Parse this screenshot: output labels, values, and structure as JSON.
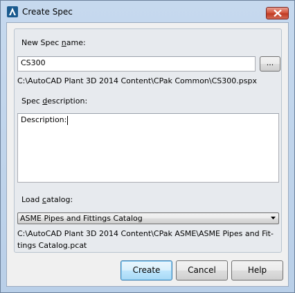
{
  "window": {
    "title": "Create Spec",
    "app_icon": "autocad-plant3d-icon",
    "close_icon": "close-icon"
  },
  "spec_name": {
    "label_before": "New Spec ",
    "label_mnemonic": "n",
    "label_after": "ame:",
    "value": "CS300",
    "browse_label": "...",
    "path": "C:\\AutoCAD Plant 3D 2014 Content\\CPak Common\\CS300.pspx"
  },
  "spec_description": {
    "label_before": "Spec ",
    "label_mnemonic": "d",
    "label_after": "escription:",
    "value": "Description:"
  },
  "catalog": {
    "label_before": "Load ",
    "label_mnemonic": "c",
    "label_after": "atalog:",
    "selected": "ASME Pipes and Fittings Catalog",
    "path_line1": "C:\\AutoCAD Plant 3D 2014 Content\\CPak ASME\\ASME Pipes and Fit-",
    "path_line2": "tings Catalog.pcat"
  },
  "buttons": {
    "create": "Create",
    "cancel": "Cancel",
    "help": "Help"
  },
  "colors": {
    "accent": "#3c7fb1",
    "close_button": "#c03a22"
  }
}
